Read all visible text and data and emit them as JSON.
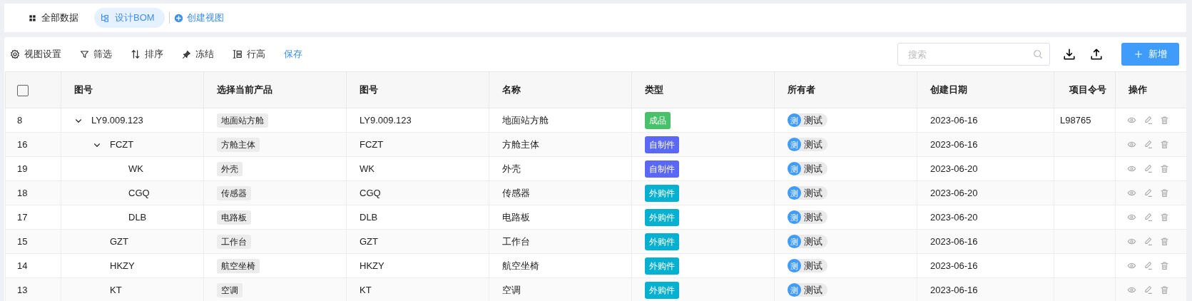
{
  "view_tabs": [
    {
      "label": "全部数据",
      "kind": "grid",
      "selected": false
    },
    {
      "label": "设计BOM",
      "kind": "tree",
      "selected": true
    }
  ],
  "create_view": "创建视图",
  "toolbar": [
    {
      "label": "视图设置",
      "kind": "gear"
    },
    {
      "label": "筛选",
      "kind": "filter"
    },
    {
      "label": "排序",
      "kind": "sort"
    },
    {
      "label": "冻结",
      "kind": "pin"
    },
    {
      "label": "行高",
      "kind": "rowheight"
    },
    {
      "label": "保存",
      "kind": "link"
    }
  ],
  "search": {
    "placeholder": "搜索"
  },
  "new_button": "新增",
  "table": {
    "select_all_checked": false,
    "columns": [
      "图号",
      "选择当前产品",
      "图号",
      "名称",
      "类型",
      "所有者",
      "创建日期",
      "项目令号",
      "操作"
    ],
    "rows": [
      {
        "index": "8",
        "code": "LY9.009.123",
        "product": "地面站方舱",
        "code_2": "LY9.009.123",
        "name": "地面站方舱",
        "type": {
          "label": "成品",
          "color": "#48c26a"
        },
        "owner": {
          "avatar": "测",
          "name": "测试"
        },
        "date": "2023-06-16",
        "project_no": "L98765",
        "expanded": true,
        "children": [
          {
            "index": "16",
            "code": "FCZT",
            "product": "方舱主体",
            "code_2": "FCZT",
            "name": "方舱主体",
            "type": {
              "label": "自制件",
              "color": "#5b67f5"
            },
            "owner": {
              "avatar": "测",
              "name": "测试"
            },
            "date": "2023-06-16",
            "expanded": true,
            "children": [
              {
                "index": "19",
                "code": "WK",
                "product": "外壳",
                "code_2": "WK",
                "name": "外壳",
                "type": {
                  "label": "自制件",
                  "color": "#5b67f5"
                },
                "owner": {
                  "avatar": "测",
                  "name": "测试"
                },
                "date": "2023-06-20"
              },
              {
                "index": "18",
                "code": "CGQ",
                "product": "传感器",
                "code_2": "CGQ",
                "name": "传感器",
                "type": {
                  "label": "外购件",
                  "color": "#06b0d0"
                },
                "owner": {
                  "avatar": "测",
                  "name": "测试"
                },
                "date": "2023-06-20"
              },
              {
                "index": "17",
                "code": "DLB",
                "product": "电路板",
                "code_2": "DLB",
                "name": "电路板",
                "type": {
                  "label": "外购件",
                  "color": "#06b0d0"
                },
                "owner": {
                  "avatar": "测",
                  "name": "测试"
                },
                "date": "2023-06-20"
              }
            ]
          },
          {
            "index": "15",
            "code": "GZT",
            "product": "工作台",
            "code_2": "GZT",
            "name": "工作台",
            "type": {
              "label": "外购件",
              "color": "#06b0d0"
            },
            "owner": {
              "avatar": "测",
              "name": "测试"
            },
            "date": "2023-06-16"
          },
          {
            "index": "14",
            "code": "HKZY",
            "product": "航空坐椅",
            "code_2": "HKZY",
            "name": "航空坐椅",
            "type": {
              "label": "外购件",
              "color": "#06b0d0"
            },
            "owner": {
              "avatar": "测",
              "name": "测试"
            },
            "date": "2023-06-16"
          },
          {
            "index": "13",
            "code": "KT",
            "product": "空调",
            "code_2": "KT",
            "name": "空调",
            "type": {
              "label": "外购件",
              "color": "#06b0d0"
            },
            "owner": {
              "avatar": "测",
              "name": "测试"
            },
            "date": "2023-06-16"
          }
        ]
      }
    ]
  }
}
